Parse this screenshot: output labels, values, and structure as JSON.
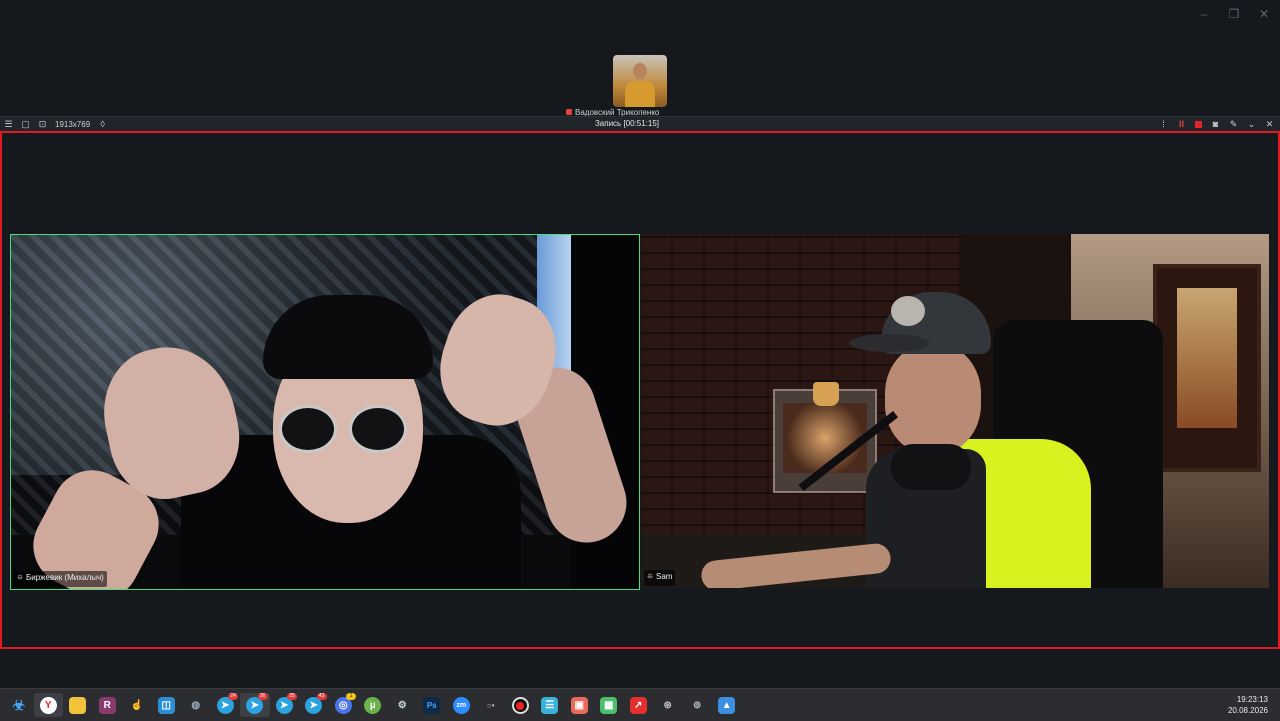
{
  "window_controls": {
    "minimize": "–",
    "restore": "❐",
    "close": "✕"
  },
  "thumbnail": {
    "label": "Вадовский Трикопенко"
  },
  "recorder": {
    "resolution": "1913x769",
    "title": "Запись [00:51:15]"
  },
  "tiles": [
    {
      "name": "Биржевик (Михалыч)"
    },
    {
      "name": "Sam"
    }
  ],
  "taskbar": {
    "badges": {
      "tg1": "24",
      "tg2": "26",
      "tg3": "25",
      "tg4": "43",
      "sync": "1"
    },
    "clock": {
      "time": "19:23:13",
      "date": "20.08.2026"
    }
  },
  "colors": {
    "recording_frame": "#e11b22",
    "active_speaker": "#45e07a",
    "highlight": "#d7f21e"
  }
}
